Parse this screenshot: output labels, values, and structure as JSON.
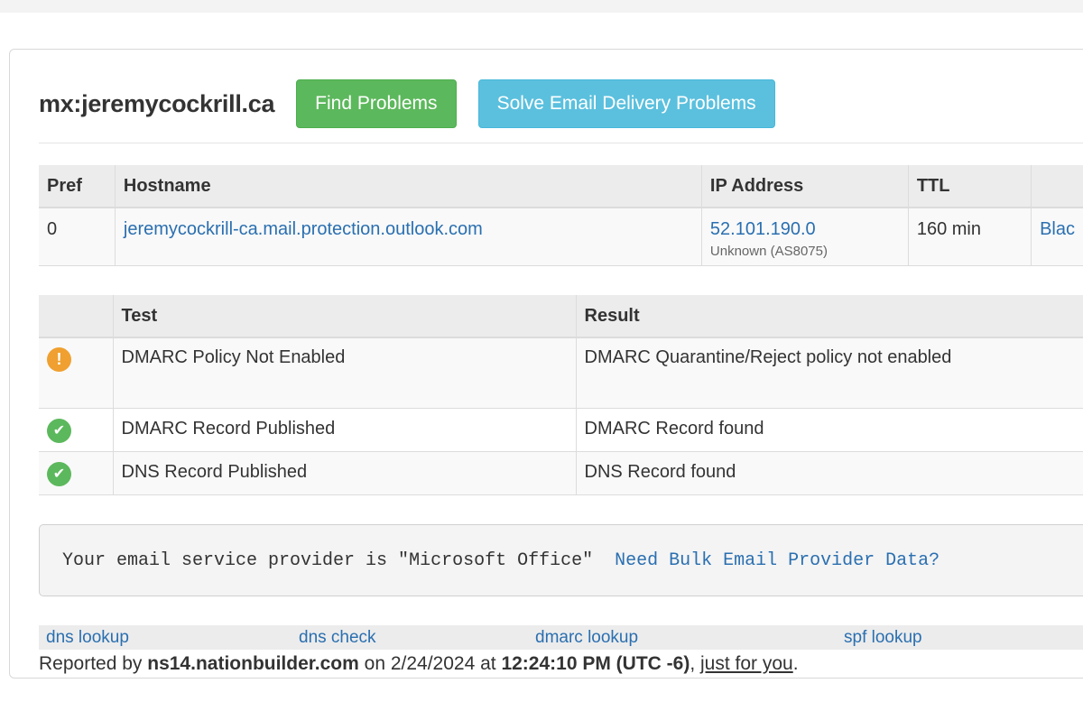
{
  "header": {
    "title": "mx:jeremycockrill.ca",
    "find_problems_label": "Find Problems",
    "solve_label": "Solve Email Delivery Problems"
  },
  "mx_table": {
    "columns": [
      "Pref",
      "Hostname",
      "IP Address",
      "TTL",
      ""
    ],
    "rows": [
      {
        "pref": "0",
        "hostname": "jeremycockrill-ca.mail.protection.outlook.com",
        "ip": "52.101.190.0",
        "ip_sub": "Unknown (AS8075)",
        "ttl": "160 min",
        "extra": "Blac"
      }
    ]
  },
  "test_table": {
    "columns": [
      "",
      "Test",
      "Result"
    ],
    "rows": [
      {
        "status": "warning",
        "test": "DMARC Policy Not Enabled",
        "result": "DMARC Quarantine/Reject policy not enabled"
      },
      {
        "status": "ok",
        "test": "DMARC Record Published",
        "result": "DMARC Record found"
      },
      {
        "status": "ok",
        "test": "DNS Record Published",
        "result": "DNS Record found"
      }
    ]
  },
  "provider": {
    "text": "Your email service provider is \"Microsoft Office\"",
    "link": "Need Bulk Email Provider Data?"
  },
  "footer": {
    "links": [
      "dns lookup",
      "dns check",
      "dmarc lookup",
      "spf lookup"
    ],
    "reported_prefix": "Reported by ",
    "server": "ns14.nationbuilder.com",
    "on": " on 2/24/2024 at ",
    "time": "12:24:10 PM (UTC -6)",
    "comma": ", ",
    "just_for_you": "just for you",
    "period": "."
  },
  "icons": {
    "warning": "exclamation-icon",
    "ok": "checkmark-icon"
  },
  "colors": {
    "green_button": "#5cb85c",
    "blue_button": "#5bc0de",
    "link": "#2a6fb0",
    "warning": "#f0a030",
    "ok": "#5cb85c"
  }
}
